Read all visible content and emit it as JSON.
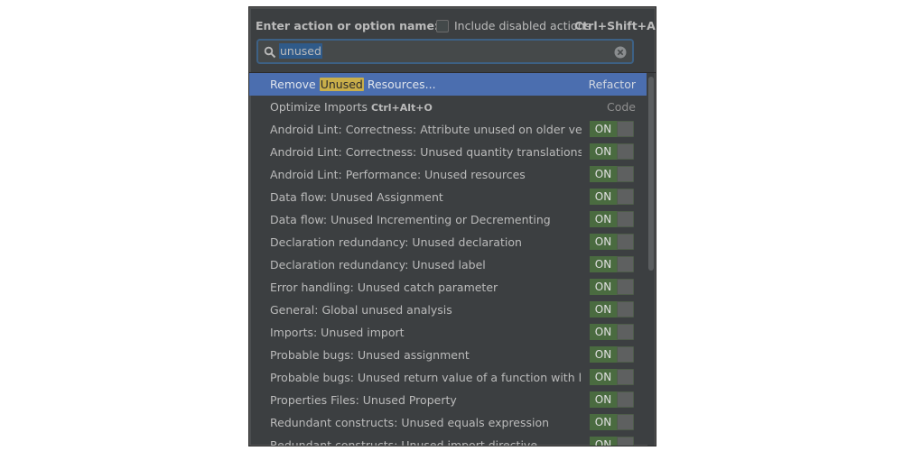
{
  "header": {
    "label": "Enter action or option name:",
    "include_label": "Include disabled actions",
    "include_shortcut": "Ctrl+Shift+A",
    "include_checked": false
  },
  "search": {
    "value": "unused",
    "icon": "search-icon",
    "clear_icon": "clear-icon"
  },
  "colors": {
    "selection": "#4b6eaf",
    "highlight": "#c9ae4a",
    "toggle_on": "#4a6b40"
  },
  "results": [
    {
      "name_pre": "Remove ",
      "name_hl": "Unused",
      "name_post": " Resources...",
      "right": "Refactor",
      "selected": true
    },
    {
      "name_pre": "Optimize Imports ",
      "shortcut": "Ctrl+Alt+O",
      "right": "Code"
    },
    {
      "name": "Android Lint: Correctness: Attribute unused on older versions",
      "toggle": "ON"
    },
    {
      "name": "Android Lint: Correctness: Unused quantity translations",
      "toggle": "ON"
    },
    {
      "name": "Android Lint: Performance: Unused resources",
      "toggle": "ON"
    },
    {
      "name": "Data flow: Unused Assignment",
      "toggle": "ON"
    },
    {
      "name": "Data flow: Unused Incrementing or Decrementing",
      "toggle": "ON"
    },
    {
      "name": "Declaration redundancy: Unused declaration",
      "toggle": "ON"
    },
    {
      "name": "Declaration redundancy: Unused label",
      "toggle": "ON"
    },
    {
      "name": "Error handling: Unused catch parameter",
      "toggle": "ON"
    },
    {
      "name": "General: Global unused analysis",
      "toggle": "ON"
    },
    {
      "name": "Imports: Unused import",
      "toggle": "ON"
    },
    {
      "name": "Probable bugs: Unused assignment",
      "toggle": "ON"
    },
    {
      "name": "Probable bugs: Unused return value of a function with lambd...",
      "toggle": "ON"
    },
    {
      "name": "Properties Files: Unused Property",
      "toggle": "ON"
    },
    {
      "name": "Redundant constructs: Unused equals expression",
      "toggle": "ON"
    },
    {
      "name": "Redundant constructs: Unused import directive",
      "toggle": "ON"
    }
  ]
}
